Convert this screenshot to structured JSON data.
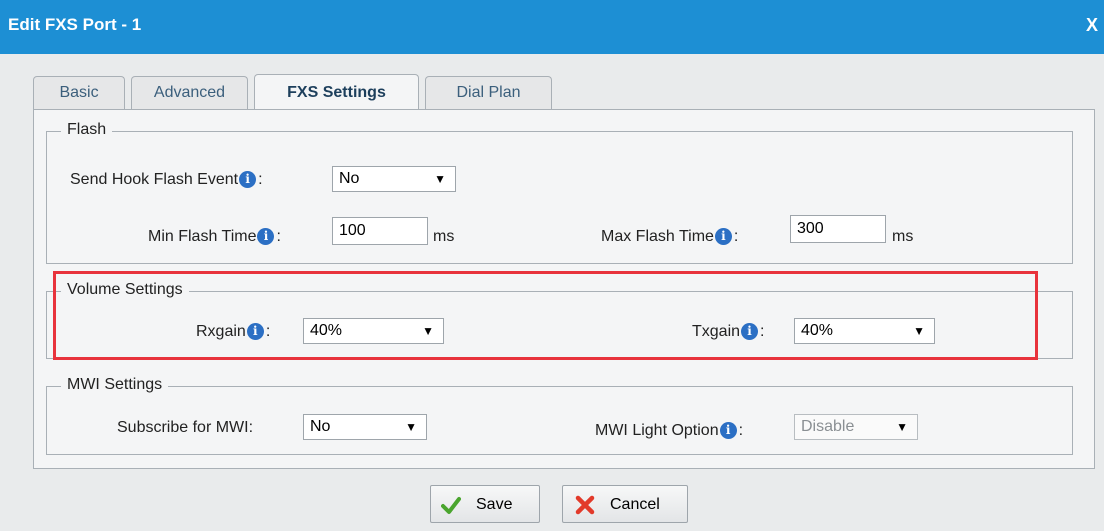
{
  "dialog": {
    "title": "Edit FXS Port - 1",
    "close_label": "X"
  },
  "tabs": [
    {
      "label": "Basic",
      "active": false
    },
    {
      "label": "Advanced",
      "active": false
    },
    {
      "label": "FXS Settings",
      "active": true
    },
    {
      "label": "Dial Plan",
      "active": false
    }
  ],
  "flash": {
    "legend": "Flash",
    "send_hook_flash_event": {
      "label": "Send Hook Flash Event",
      "value": "No"
    },
    "min_flash_time": {
      "label": "Min Flash Time",
      "value": "100",
      "unit": "ms"
    },
    "max_flash_time": {
      "label": "Max Flash Time",
      "value": "300",
      "unit": "ms"
    }
  },
  "volume": {
    "legend": "Volume Settings",
    "rxgain": {
      "label": "Rxgain",
      "value": "40%"
    },
    "txgain": {
      "label": "Txgain",
      "value": "40%"
    }
  },
  "mwi": {
    "legend": "MWI Settings",
    "subscribe": {
      "label": "Subscribe for MWI:",
      "value": "No"
    },
    "light_option": {
      "label": "MWI Light Option",
      "value": "Disable"
    }
  },
  "buttons": {
    "save_label": "Save",
    "cancel_label": "Cancel"
  },
  "icons": {
    "info": "i",
    "dropdown_arrow": "▼"
  },
  "colors": {
    "titlebar": "#1d8fd4",
    "highlight_border": "#e8333c",
    "info_icon": "#2b6fc4"
  }
}
